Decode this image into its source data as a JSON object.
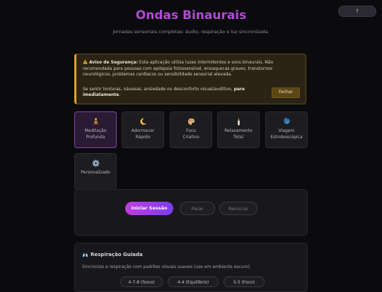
{
  "header": {
    "title": "Ondas Binaurais",
    "subtitle": "Jornadas sensoriais completas: áudio, respiração e luz sincronizada.",
    "help_label": "?"
  },
  "warning": {
    "heading": "Aviso de Segurança:",
    "body": "Esta aplicação utiliza luzes intermitentes e sons binaurais. Não recomendada para pessoas com epilepsia fotossensível, enxaquecas graves, transtornos neurológicos, problemas cardíacos ou sensibilidade sensorial elevada.",
    "instruction_prefix": "Se sentir tonturas, náuseas, ansiedade ou desconforto visual/auditivo,",
    "instruction_bold": "pare imediatamente",
    "instruction_suffix": ".",
    "close_label": "Fechar",
    "accent_color": "#e0a526"
  },
  "modes": [
    {
      "line1": "Meditação",
      "line2": "Profunda",
      "icon": "meditation-icon",
      "active": true
    },
    {
      "line1": "Adormecer",
      "line2": "Rápido",
      "icon": "moon-icon",
      "active": false
    },
    {
      "line1": "Foco",
      "line2": "Criativo",
      "icon": "palette-icon",
      "active": false
    },
    {
      "line1": "Relaxamento",
      "line2": "Total",
      "icon": "candle-icon",
      "active": false
    },
    {
      "line1": "Viagem",
      "line2": "Estroboscópica",
      "icon": "spiral-icon",
      "active": false
    },
    {
      "line1": "Personalizado",
      "line2": "",
      "icon": "gear-icon",
      "active": false
    }
  ],
  "controls": {
    "start_label": "Iniciar Sessão",
    "stop_label": "Parar",
    "restart_label": "Reiniciar"
  },
  "breathing": {
    "title": "Respiração Guiada",
    "description": "Sincronize a respiração com padrões visuais suaves (use em ambiente escuro).",
    "patterns": [
      "4-7-8 (Sono)",
      "4-4 (Equilíbrio)",
      "5-5 (Foco)"
    ]
  },
  "colors": {
    "brand": "#b14ad3",
    "start_gradient_from": "#c13ee0",
    "start_gradient_to": "#7b3cf0"
  }
}
